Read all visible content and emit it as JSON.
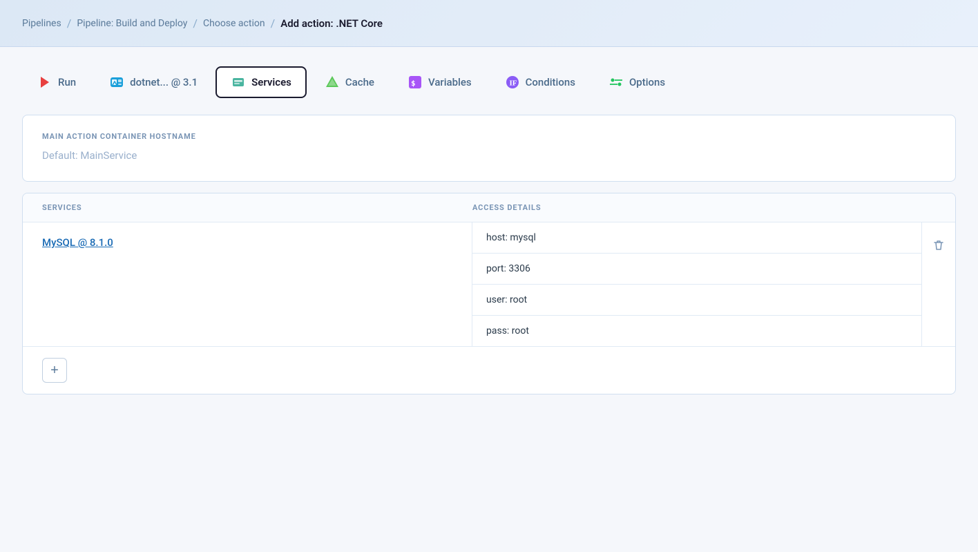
{
  "breadcrumb": {
    "items": [
      "Pipelines",
      "Pipeline: Build and Deploy",
      "Choose action"
    ],
    "current": "Add action: .NET Core",
    "separators": [
      "/",
      "/",
      "/"
    ]
  },
  "tabs": [
    {
      "id": "run",
      "label": "Run",
      "icon": "run-icon",
      "active": false
    },
    {
      "id": "dotnet",
      "label": "dotnet... @ 3.1",
      "icon": "dotnet-icon",
      "active": false
    },
    {
      "id": "services",
      "label": "Services",
      "icon": "services-icon",
      "active": true
    },
    {
      "id": "cache",
      "label": "Cache",
      "icon": "cache-icon",
      "active": false
    },
    {
      "id": "variables",
      "label": "Variables",
      "icon": "variables-icon",
      "active": false
    },
    {
      "id": "conditions",
      "label": "Conditions",
      "icon": "conditions-icon",
      "active": false
    },
    {
      "id": "options",
      "label": "Options",
      "icon": "options-icon",
      "active": false
    }
  ],
  "hostname_section": {
    "label": "MAIN ACTION CONTAINER HOSTNAME",
    "value": "Default: MainService"
  },
  "services_table": {
    "col_services": "SERVICES",
    "col_access": "ACCESS DETAILS",
    "rows": [
      {
        "name": "MySQL @ 8.1.0",
        "access_details": [
          "host: mysql",
          "port: 3306",
          "user: root",
          "pass: root"
        ]
      }
    ]
  },
  "add_button_label": "+",
  "colors": {
    "run_icon": "#e84040",
    "services_icon": "#4ab5a0",
    "cache_icon": "#5cc85a",
    "variables_icon": "#a855f7",
    "conditions_icon": "#8b5cf6",
    "options_icon": "#22c55e"
  }
}
